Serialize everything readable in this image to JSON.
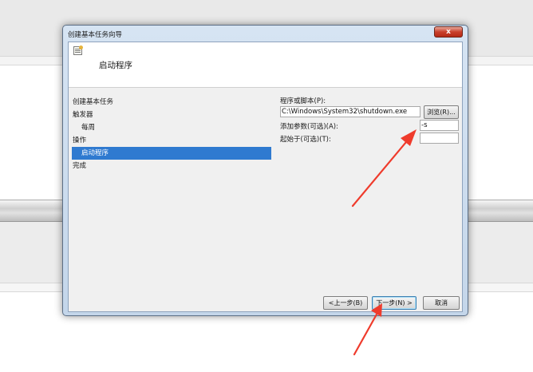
{
  "window": {
    "title": "创建基本任务向导",
    "close_label": "x"
  },
  "header": {
    "title": "启动程序",
    "icon": "task-scheduler-icon"
  },
  "steps": [
    {
      "label": "创建基本任务",
      "active": false
    },
    {
      "label": "触发器",
      "active": false
    },
    {
      "label": "每周",
      "active": false
    },
    {
      "label": "操作",
      "active": false
    },
    {
      "label": "启动程序",
      "active": true
    },
    {
      "label": "完成",
      "active": false
    }
  ],
  "form": {
    "program_label": "程序或脚本(P):",
    "program_value": "C:\\Windows\\System32\\shutdown.exe",
    "browse_label": "浏览(R)...",
    "args_label": "添加参数(可选)(A):",
    "args_value": "-s",
    "start_in_label": "起始于(可选)(T):",
    "start_in_value": ""
  },
  "buttons": {
    "back": "<上一步(B)",
    "next": "下一步(N) >",
    "cancel": "取消"
  },
  "colors": {
    "selection": "#2f7ad0",
    "annotation_arrow": "#ef3b2c"
  }
}
